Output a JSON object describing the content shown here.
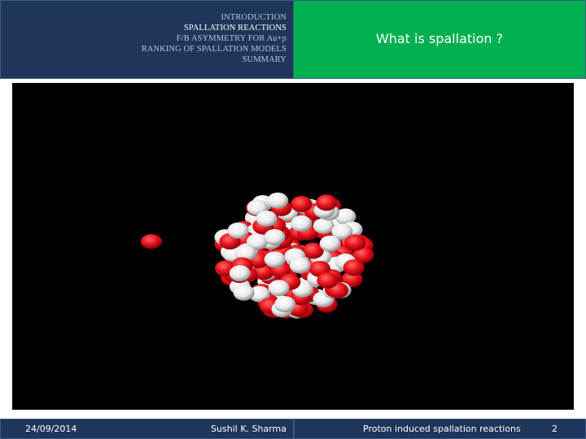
{
  "nav": {
    "items": [
      {
        "label": "INTRODUCTION",
        "active": false
      },
      {
        "label": "SPALLATION REACTIONS",
        "active": true
      },
      {
        "label": "F/B ASYMMETRY FOR Au+p",
        "active": false
      },
      {
        "label": "RANKING OF SPALLATION MODELS",
        "active": false
      },
      {
        "label": "SUMMARY",
        "active": false
      }
    ]
  },
  "slide": {
    "title": "What is spallation ?"
  },
  "animation": {
    "colors": {
      "proton": "#e8101a",
      "neutron": "#ffffff",
      "background": "#000000"
    }
  },
  "footer": {
    "date": "24/09/2014",
    "author": "Sushil K. Sharma",
    "caption": "Proton induced spallation reactions",
    "page": "2"
  },
  "theme": {
    "header_dark": "#1f3559",
    "header_green": "#00b050"
  }
}
